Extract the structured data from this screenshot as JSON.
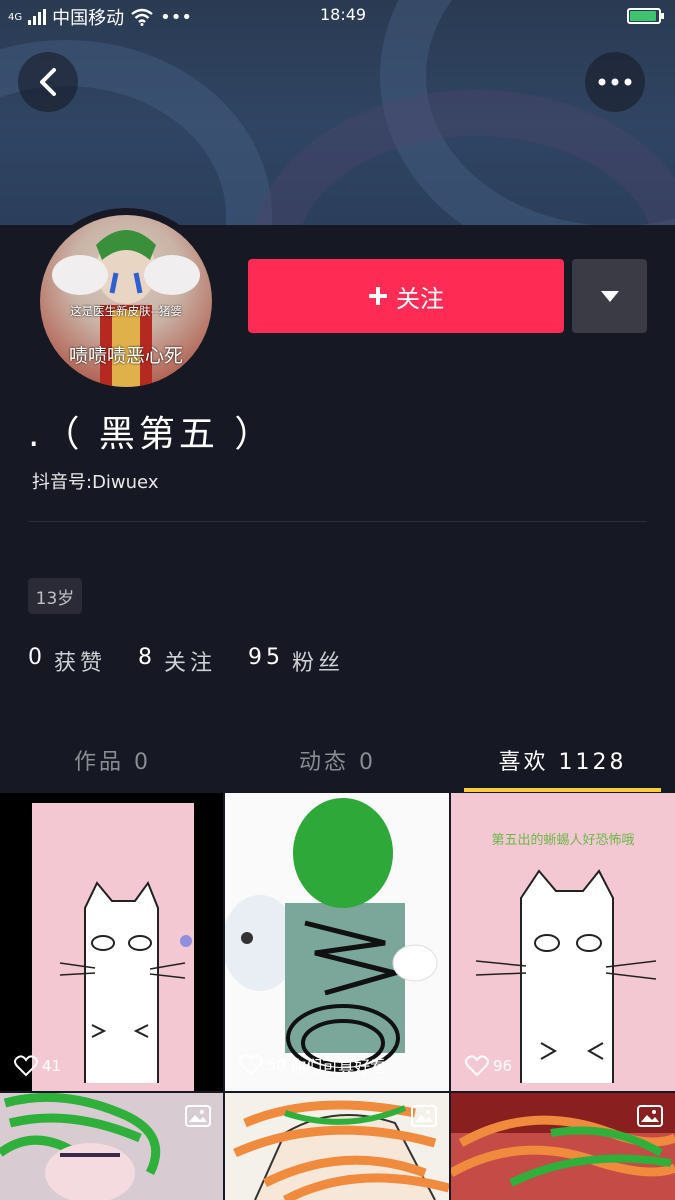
{
  "status_bar": {
    "network": "4G",
    "carrier": "中国移动",
    "dots": "•••",
    "time": "18:49"
  },
  "profile": {
    "avatar_caption_top": "这是医生新皮肤--猪婆",
    "avatar_caption_bottom": "啧啧啧恶心死",
    "follow_label": "关注",
    "nickname": ".（ 黑第五 ）",
    "douyin_id": "抖音号:Diwuex",
    "age": "13岁",
    "stats": {
      "likes": {
        "count": "0",
        "label": "获赞"
      },
      "following": {
        "count": "8",
        "label": "关注"
      },
      "followers": {
        "count": "95",
        "label": "粉丝"
      }
    }
  },
  "tabs": [
    {
      "label": "作品 0",
      "active": false
    },
    {
      "label": "动态 0",
      "active": false
    },
    {
      "label": "喜欢 1128",
      "active": true
    }
  ],
  "grid": [
    {
      "likes": "41",
      "caption": ""
    },
    {
      "likes": "50",
      "caption": "你们可真好看"
    },
    {
      "likes": "96",
      "caption": "第五出的蜥蜴人好恐怖哦"
    },
    {
      "likes": "",
      "caption": ""
    },
    {
      "likes": "",
      "caption": ""
    },
    {
      "likes": "",
      "caption": ""
    }
  ],
  "colors": {
    "background": "#161823",
    "follow_button": "#fe2c55",
    "tab_underline": "#facd3c"
  }
}
